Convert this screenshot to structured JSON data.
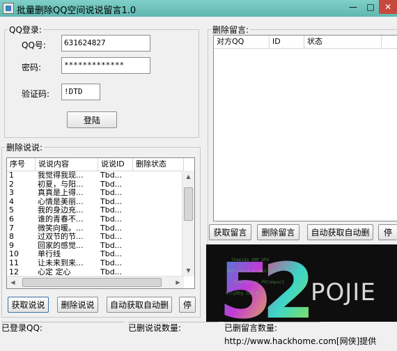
{
  "window": {
    "title": "批量删除QQ空间说说留言1.0",
    "min": "—",
    "max": "□",
    "close": "✕"
  },
  "login": {
    "legend": "QQ登录:",
    "qq_label": "QQ号:",
    "qq_value": "631624827",
    "pwd_label": "密码:",
    "pwd_value": "*************",
    "captcha_label": "验证码:",
    "captcha_value": "!DTD",
    "login_button": "登陆"
  },
  "shuoshuo": {
    "legend": "删除说说:",
    "columns": [
      "序号",
      "说说内容",
      "说说ID",
      "删除状态"
    ],
    "rows": [
      [
        "1",
        "我觉得我现...",
        "Tbd..."
      ],
      [
        "2",
        "初夏，与阳...",
        "Tbd..."
      ],
      [
        "3",
        "真真是上得...",
        "Tbd..."
      ],
      [
        "4",
        "心情是美丽...",
        "Tbd..."
      ],
      [
        "5",
        "我的身边充...",
        "Tbd..."
      ],
      [
        "6",
        "谁的青春不...",
        "Tbd..."
      ],
      [
        "7",
        "微笑向暖。...",
        "Tbd..."
      ],
      [
        "8",
        "过双节的节...",
        "Tbd..."
      ],
      [
        "9",
        "回家的感觉...",
        "Tbd..."
      ],
      [
        "10",
        "单行线",
        "Tbd..."
      ],
      [
        "11",
        "让未来到来...",
        "Tbd..."
      ],
      [
        "12",
        "心定 定心",
        "Tbd..."
      ]
    ],
    "buttons": {
      "fetch": "获取说说",
      "delete": "删除说说",
      "auto": "自动获取自动删",
      "stop": "停"
    }
  },
  "liuyan": {
    "legend": "删除留言:",
    "columns": [
      "对方QQ",
      "ID",
      "状态"
    ],
    "buttons": {
      "fetch": "获取留言",
      "delete": "删除留言",
      "auto": "自动获取自动删",
      "stop": "停"
    }
  },
  "banner": {
    "logo_text": "52pojie"
  },
  "status": {
    "logged_in": "已登录QQ:",
    "deleted_shuoshuo": "已删说说数量:",
    "deleted_liuyan": "已删留言数量:"
  },
  "watermark": "http://www.hackhome.com[网侠]提供",
  "colors": {
    "titlebar": "#5fb7b0",
    "close": "#c7483e",
    "window_bg": "#f0f0f0"
  }
}
